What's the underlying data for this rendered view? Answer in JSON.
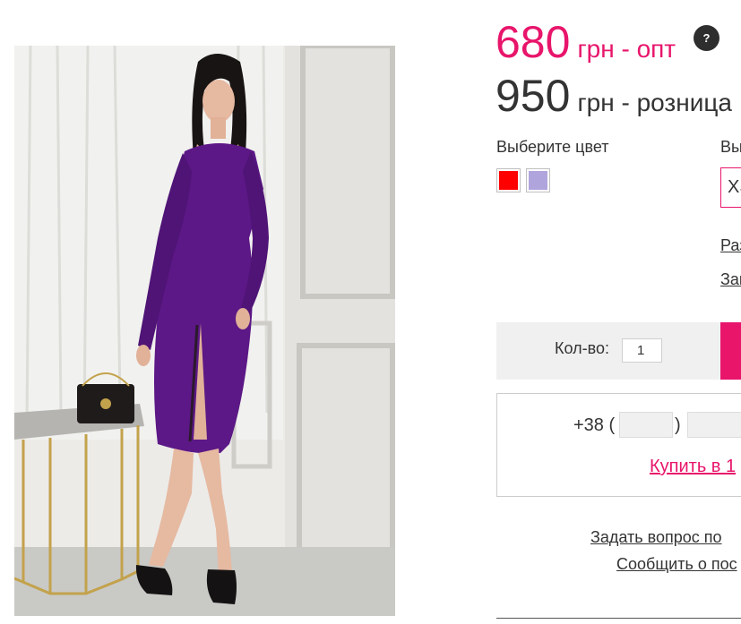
{
  "product": {
    "image_alt": "product-photo-purple-dress"
  },
  "pricing": {
    "wholesale_amount": "680",
    "wholesale_label": "грн - опт",
    "retail_amount": "950",
    "retail_label": "грн - розница",
    "help_glyph": "?"
  },
  "color": {
    "label": "Выберите цвет",
    "swatches": [
      {
        "name": "red",
        "hex": "#ff0000"
      },
      {
        "name": "lavender",
        "hex": "#b0a4dc"
      }
    ]
  },
  "size": {
    "label": "Вы",
    "selected": "XS",
    "links": [
      "Раз",
      "Зап"
    ]
  },
  "quantity": {
    "label": "Кол-во:",
    "value": "1"
  },
  "one_click": {
    "prefix": "+38 (",
    "paren_close": ")",
    "link_label": "Купить в 1"
  },
  "bottom_links": {
    "ask_question": "Задать вопрос по",
    "report": "Сообщить о пос"
  },
  "colors": {
    "accent": "#e8156b",
    "text": "#333333",
    "panel": "#f0f0f0",
    "dress": "#5c1886"
  }
}
